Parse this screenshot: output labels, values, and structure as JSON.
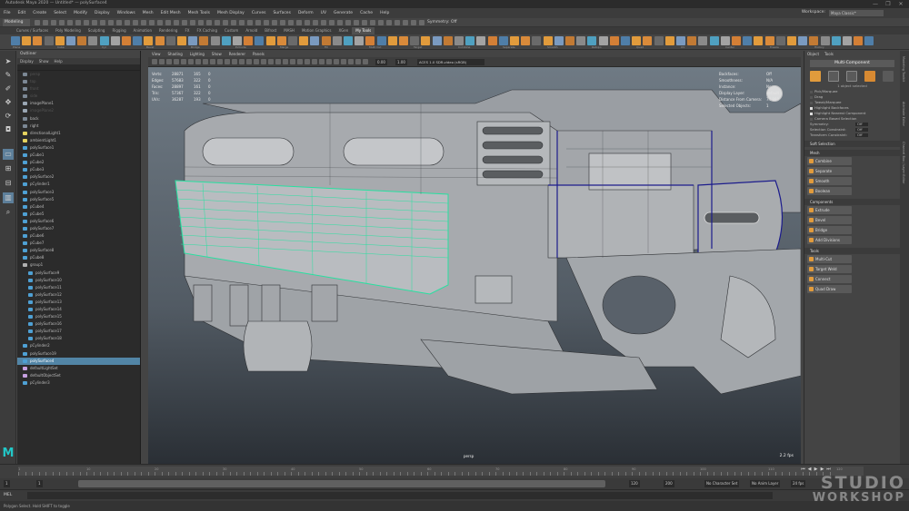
{
  "window": {
    "title": "Autodesk Maya 2020 — Untitled* — polySurface4",
    "controls": [
      "—",
      "❐",
      "✕"
    ]
  },
  "menubar": {
    "items": [
      "File",
      "Edit",
      "Create",
      "Select",
      "Modify",
      "Display",
      "Windows",
      "Mesh",
      "Edit Mesh",
      "Mesh Tools",
      "Mesh Display",
      "Curves",
      "Surfaces",
      "Deform",
      "UV",
      "Generate",
      "Cache",
      "Help"
    ],
    "workspace_label": "Workspace:",
    "workspace_value": "Maya Classic*"
  },
  "statusline": {
    "mode": "Modeling",
    "symmetry": "Symmetry: Off"
  },
  "shelf": {
    "tabs": [
      "Curves / Surfaces",
      "Poly Modeling",
      "Sculpting",
      "Rigging",
      "Animation",
      "Rendering",
      "FX",
      "FX Caching",
      "Custom",
      "Arnold",
      "Bifrost",
      "MASH",
      "Motion Graphics",
      "XGen",
      "My Tools"
    ],
    "active_tab": "My Tools",
    "labels": [
      "Plane",
      "Cube",
      "Cyl",
      "Bevel",
      "Bridge",
      "Extrude",
      "Merge",
      "Fill",
      "Multi Cut",
      "Target",
      "Combine",
      "Separate",
      "Smooth",
      "Retopo",
      "Quad",
      "UV",
      "Center",
      "Freeze",
      "History"
    ]
  },
  "outliner": {
    "title": "Outliner",
    "menu": [
      "Display",
      "Show",
      "Help"
    ],
    "items": [
      {
        "name": "persp",
        "indent": 0,
        "icon": "camera",
        "dim": true
      },
      {
        "name": "top",
        "indent": 0,
        "icon": "camera",
        "dim": true
      },
      {
        "name": "front",
        "indent": 0,
        "icon": "camera",
        "dim": true
      },
      {
        "name": "side",
        "indent": 0,
        "icon": "camera",
        "dim": true
      },
      {
        "name": "imagePlane1",
        "indent": 0,
        "icon": "image",
        "dim": false
      },
      {
        "name": "imagePlane2",
        "indent": 0,
        "icon": "image",
        "dim": true
      },
      {
        "name": "back",
        "indent": 0,
        "icon": "camera",
        "dim": false
      },
      {
        "name": "right",
        "indent": 0,
        "icon": "camera",
        "dim": false
      },
      {
        "name": "directionalLight1",
        "indent": 0,
        "icon": "light",
        "dim": false
      },
      {
        "name": "ambientLight1",
        "indent": 0,
        "icon": "light",
        "dim": false
      },
      {
        "name": "polySurface1",
        "indent": 0,
        "icon": "mesh",
        "dim": false
      },
      {
        "name": "pCube1",
        "indent": 0,
        "icon": "mesh",
        "dim": false
      },
      {
        "name": "pCube2",
        "indent": 0,
        "icon": "mesh",
        "dim": false
      },
      {
        "name": "pCube3",
        "indent": 0,
        "icon": "mesh",
        "dim": false
      },
      {
        "name": "polySurface2",
        "indent": 0,
        "icon": "mesh",
        "dim": false
      },
      {
        "name": "pCylinder1",
        "indent": 0,
        "icon": "mesh",
        "dim": false
      },
      {
        "name": "polySurface3",
        "indent": 0,
        "icon": "mesh",
        "dim": false
      },
      {
        "name": "polySurface5",
        "indent": 0,
        "icon": "mesh",
        "dim": false
      },
      {
        "name": "pCube4",
        "indent": 0,
        "icon": "mesh",
        "dim": false
      },
      {
        "name": "pCube5",
        "indent": 0,
        "icon": "mesh",
        "dim": false
      },
      {
        "name": "polySurface6",
        "indent": 0,
        "icon": "mesh",
        "dim": false
      },
      {
        "name": "polySurface7",
        "indent": 0,
        "icon": "mesh",
        "dim": false
      },
      {
        "name": "pCube6",
        "indent": 0,
        "icon": "mesh",
        "dim": false
      },
      {
        "name": "pCube7",
        "indent": 0,
        "icon": "mesh",
        "dim": false
      },
      {
        "name": "polySurface8",
        "indent": 0,
        "icon": "mesh",
        "dim": false
      },
      {
        "name": "pCube8",
        "indent": 0,
        "icon": "mesh",
        "dim": false
      },
      {
        "name": "group1",
        "indent": 0,
        "icon": "group",
        "dim": false
      },
      {
        "name": "polySurface9",
        "indent": 1,
        "icon": "mesh",
        "dim": false
      },
      {
        "name": "polySurface10",
        "indent": 1,
        "icon": "mesh",
        "dim": false
      },
      {
        "name": "polySurface11",
        "indent": 1,
        "icon": "mesh",
        "dim": false
      },
      {
        "name": "polySurface12",
        "indent": 1,
        "icon": "mesh",
        "dim": false
      },
      {
        "name": "polySurface13",
        "indent": 1,
        "icon": "mesh",
        "dim": false
      },
      {
        "name": "polySurface14",
        "indent": 1,
        "icon": "mesh",
        "dim": false
      },
      {
        "name": "polySurface15",
        "indent": 1,
        "icon": "mesh",
        "dim": false
      },
      {
        "name": "polySurface16",
        "indent": 1,
        "icon": "mesh",
        "dim": false
      },
      {
        "name": "polySurface17",
        "indent": 1,
        "icon": "mesh",
        "dim": false
      },
      {
        "name": "polySurface18",
        "indent": 1,
        "icon": "mesh",
        "dim": false
      },
      {
        "name": "pCylinder2",
        "indent": 0,
        "icon": "mesh",
        "dim": false
      },
      {
        "name": "polySurface19",
        "indent": 0,
        "icon": "mesh",
        "dim": false
      },
      {
        "name": "polySurface4",
        "indent": 0,
        "icon": "mesh",
        "dim": false,
        "selected": true
      },
      {
        "name": "defaultLightSet",
        "indent": 0,
        "icon": "set",
        "dim": false
      },
      {
        "name": "defaultObjectSet",
        "indent": 0,
        "icon": "set",
        "dim": false
      },
      {
        "name": "pCylinder3",
        "indent": 0,
        "icon": "mesh",
        "dim": false
      }
    ]
  },
  "viewport": {
    "menu": [
      "View",
      "Shading",
      "Lighting",
      "Show",
      "Renderer",
      "Panels"
    ],
    "near": "0.00",
    "far": "1.00",
    "colorspace": "ACES 1.0 SDR-video (sRGB)",
    "hud_stats": [
      {
        "label": "Verts:",
        "a": "28871",
        "b": "165",
        "c": "0"
      },
      {
        "label": "Edges:",
        "a": "57683",
        "b": "322",
        "c": "0"
      },
      {
        "label": "Faces:",
        "a": "28897",
        "b": "161",
        "c": "0"
      },
      {
        "label": "Tris:",
        "a": "57367",
        "b": "322",
        "c": "0"
      },
      {
        "label": "UVs:",
        "a": "36287",
        "b": "193",
        "c": "0"
      }
    ],
    "hud_right": [
      {
        "label": "Backfaces:",
        "value": "Off"
      },
      {
        "label": "Smoothness:",
        "value": "N/A"
      },
      {
        "label": "Instance:",
        "value": "No"
      },
      {
        "label": "Display Layer:",
        "value": "default"
      },
      {
        "label": "Distance From Camera:",
        "value": "74.890"
      },
      {
        "label": "Selected Objects:",
        "value": "1"
      }
    ],
    "camera": "persp",
    "fps": "2.2 fps"
  },
  "modeling_toolkit": {
    "tabs": [
      "Object",
      "Tools"
    ],
    "title": "Multi-Component",
    "subtitle": "1 object selected",
    "options": [
      {
        "label": "Pick/Marquee",
        "checked": false
      },
      {
        "label": "Drag",
        "checked": false
      },
      {
        "label": "Tweak/Marquee",
        "checked": false
      },
      {
        "label": "Highlight Backfaces",
        "checked": true
      },
      {
        "label": "Highlight Nearest Component",
        "checked": true
      },
      {
        "label": "Camera Based Selection",
        "checked": false
      }
    ],
    "symmetry_label": "Symmetry:",
    "symmetry_value": "Off",
    "selection_constraint_label": "Selection Constraint:",
    "selection_constraint_value": "Off",
    "transform_constraint_label": "Transform Constraint:",
    "transform_constraint_value": "Off",
    "sections": [
      {
        "name": "Soft Selection",
        "buttons": []
      },
      {
        "name": "Mesh",
        "buttons": [
          "Combine",
          "Separate",
          "Smooth",
          "Boolean"
        ]
      },
      {
        "name": "Components",
        "buttons": [
          "Extrude",
          "Bevel",
          "Bridge",
          "Add Divisions"
        ]
      },
      {
        "name": "Tools",
        "buttons": [
          "Multi-Cut",
          "Target Weld",
          "Connect",
          "Quad Draw"
        ]
      }
    ],
    "side_tabs": [
      "Modeling Toolkit",
      "Attribute Editor",
      "Channel Box / Layer Editor"
    ]
  },
  "timeline": {
    "ticks": [
      "1",
      "10",
      "20",
      "30",
      "40",
      "50",
      "60",
      "70",
      "80",
      "90",
      "100",
      "110",
      "120"
    ],
    "range_start": "1",
    "range_inner_start": "1",
    "range_end": "120",
    "range_outer_end": "200",
    "no_character_set": "No Character Set",
    "no_anim_layer": "No Anim Layer",
    "fps_setting": "24 fps"
  },
  "commandline": {
    "language": "MEL",
    "help_text": "Polygon Select. Hold SHIFT to toggle"
  },
  "watermark": {
    "line1": "STUDIO",
    "line2": "WORKSHOP"
  },
  "colors": {
    "selection_blue": "#5285a6",
    "wire_green": "#28e0a0",
    "wire_blue": "#1c1c8c",
    "maya_logo": "#22c7c7"
  }
}
